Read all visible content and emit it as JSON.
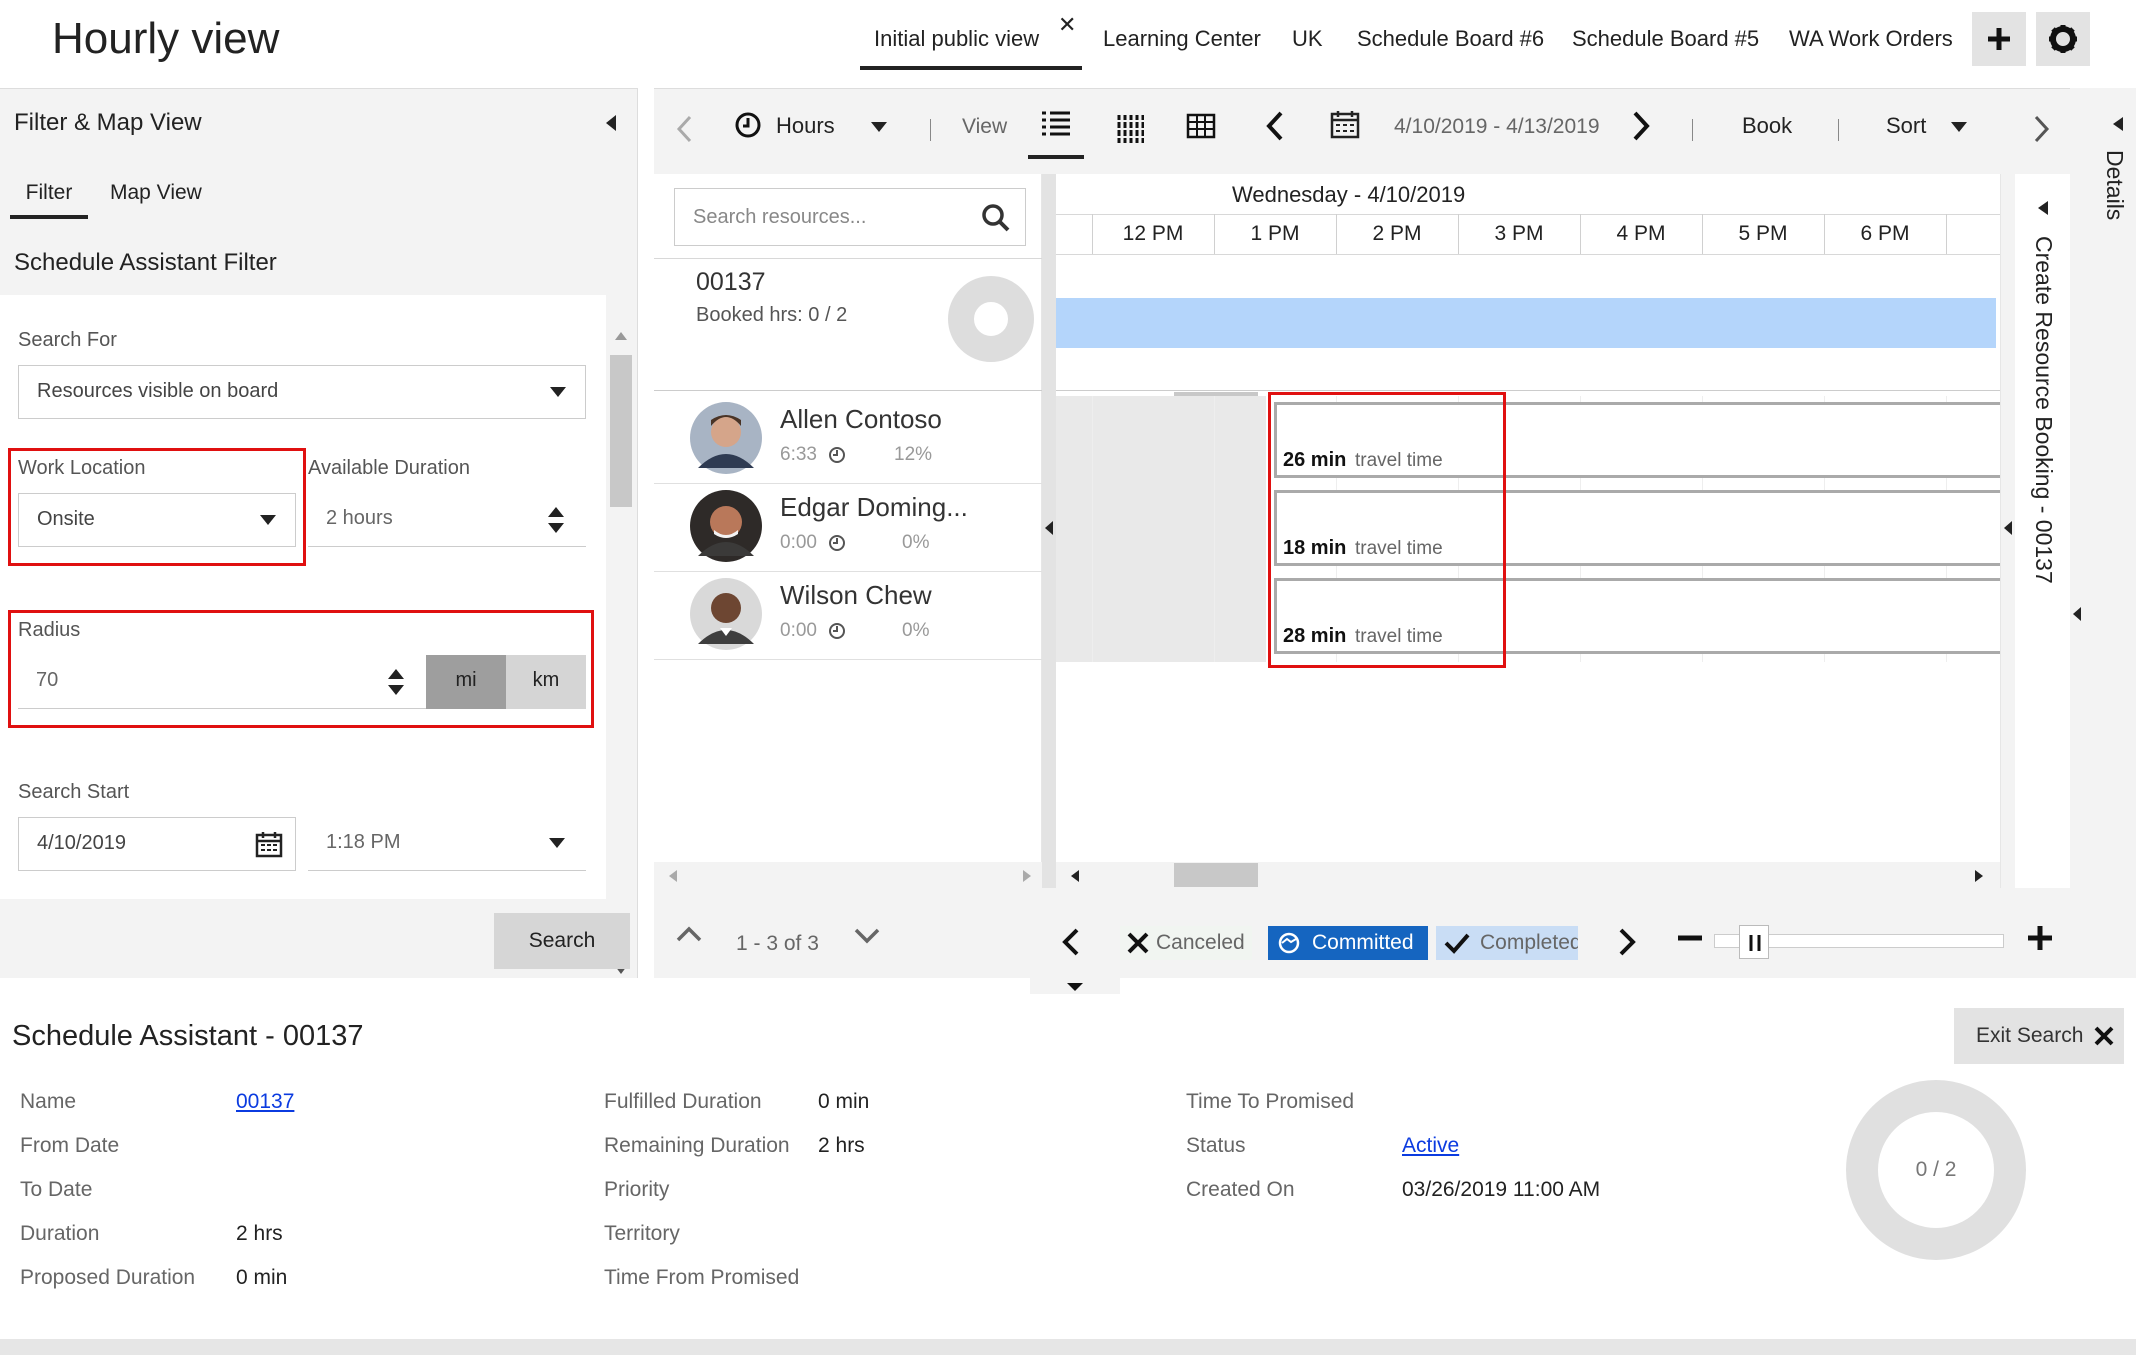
{
  "app": {
    "title": "Hourly view"
  },
  "tabs": [
    {
      "label": "Initial public view",
      "active": true
    },
    {
      "label": "Learning Center"
    },
    {
      "label": "UK"
    },
    {
      "label": "Schedule Board #6"
    },
    {
      "label": "Schedule Board #5"
    },
    {
      "label": "WA Work Orders"
    }
  ],
  "filter_panel": {
    "title": "Filter & Map View",
    "tabs": [
      "Filter",
      "Map View"
    ],
    "section_title": "Schedule Assistant Filter",
    "search_for_label": "Search For",
    "search_for_value": "Resources visible on board",
    "work_location_label": "Work Location",
    "work_location_value": "Onsite",
    "available_duration_label": "Available Duration",
    "available_duration_value": "2 hours",
    "radius_label": "Radius",
    "radius_value": "70",
    "unit_mi": "mi",
    "unit_km": "km",
    "search_start_label": "Search Start",
    "search_start_date": "4/10/2019",
    "search_start_time": "1:18 PM",
    "search_button": "Search"
  },
  "toolbar": {
    "hours_label": "Hours",
    "view_label": "View",
    "date_range": "4/10/2019 - 4/13/2019",
    "book_label": "Book",
    "sort_label": "Sort"
  },
  "resources": {
    "search_placeholder": "Search resources...",
    "requirement_id": "00137",
    "requirement_booked": "Booked hrs: 0 / 2",
    "items": [
      {
        "name": "Allen Contoso",
        "time": "6:33",
        "percent": "12%"
      },
      {
        "name": "Edgar Doming...",
        "time": "0:00",
        "percent": "0%"
      },
      {
        "name": "Wilson Chew",
        "time": "0:00",
        "percent": "0%"
      }
    ],
    "pagination": "1 - 3 of 3"
  },
  "timeline": {
    "day_label": "Wednesday - 4/10/2019",
    "hours": [
      "M",
      "12 PM",
      "1 PM",
      "2 PM",
      "3 PM",
      "4 PM",
      "5 PM",
      "6 PM"
    ],
    "travel": [
      {
        "minutes": "26 min",
        "suffix": "travel time"
      },
      {
        "minutes": "18 min",
        "suffix": "travel time"
      },
      {
        "minutes": "28 min",
        "suffix": "travel time"
      }
    ]
  },
  "legend": {
    "canceled": "Canceled",
    "committed": "Committed",
    "completed": "Completed"
  },
  "side_panels": {
    "create_booking": "Create Resource Booking - 00137",
    "details": "Details"
  },
  "assistant": {
    "title": "Schedule Assistant - 00137",
    "exit_search": "Exit Search",
    "col1": [
      {
        "label": "Name",
        "value": "00137",
        "link": true
      },
      {
        "label": "From Date",
        "value": ""
      },
      {
        "label": "To Date",
        "value": ""
      },
      {
        "label": "Duration",
        "value": "2 hrs"
      },
      {
        "label": "Proposed Duration",
        "value": "0 min"
      }
    ],
    "col2": [
      {
        "label": "Fulfilled Duration",
        "value": "0 min"
      },
      {
        "label": "Remaining Duration",
        "value": "2 hrs"
      },
      {
        "label": "Priority",
        "value": ""
      },
      {
        "label": "Territory",
        "value": ""
      },
      {
        "label": "Time From Promised",
        "value": ""
      }
    ],
    "col3": [
      {
        "label": "Time To Promised",
        "value": ""
      },
      {
        "label": "Status",
        "value": "Active",
        "link": true
      },
      {
        "label": "Created On",
        "value": "03/26/2019 11:00 AM"
      }
    ],
    "donut_label": "0 / 2"
  },
  "colors": {
    "accent_blue": "#0078d4",
    "committed_bg": "#1565c0",
    "completed_bg": "#c9ddf5",
    "booking_bar": "#b4d5fb",
    "highlight_red": "#e01010"
  }
}
